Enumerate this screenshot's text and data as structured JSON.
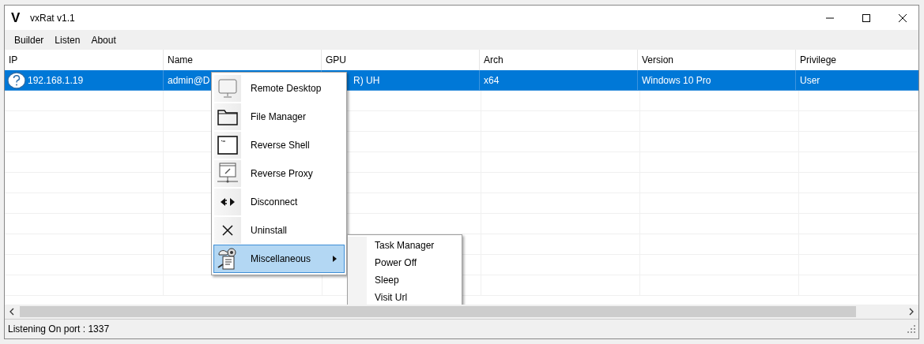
{
  "window": {
    "logo": "V",
    "title": "vxRat v1.1"
  },
  "menu": [
    "Builder",
    "Listen",
    "About"
  ],
  "table": {
    "columns": [
      "IP",
      "Name",
      "GPU",
      "Arch",
      "Version",
      "Privilege"
    ],
    "rows": [
      {
        "selected": true,
        "cells": [
          "192.168.1.19",
          "admin@D",
          "R) UH",
          "x64",
          "Windows 10 Pro",
          "User"
        ]
      }
    ]
  },
  "context_menu": {
    "items": [
      {
        "kind": "monitor",
        "label": "Remote Desktop",
        "highlighted": false,
        "has_submenu": false
      },
      {
        "kind": "folder",
        "label": "File Manager",
        "highlighted": false,
        "has_submenu": false
      },
      {
        "kind": "terminal",
        "label": "Reverse Shell",
        "highlighted": false,
        "has_submenu": false
      },
      {
        "kind": "proxy",
        "label": "Reverse Proxy",
        "highlighted": false,
        "has_submenu": false
      },
      {
        "kind": "plug",
        "label": "Disconnect",
        "highlighted": false,
        "has_submenu": false
      },
      {
        "kind": "cross",
        "label": "Uninstall",
        "highlighted": false,
        "has_submenu": false
      },
      {
        "kind": "gears",
        "label": "Miscellaneous",
        "highlighted": true,
        "has_submenu": true
      }
    ],
    "submenu": [
      "Task Manager",
      "Power Off",
      "Sleep",
      "Visit Url"
    ]
  },
  "status_bar": "Listening On port : 1337"
}
